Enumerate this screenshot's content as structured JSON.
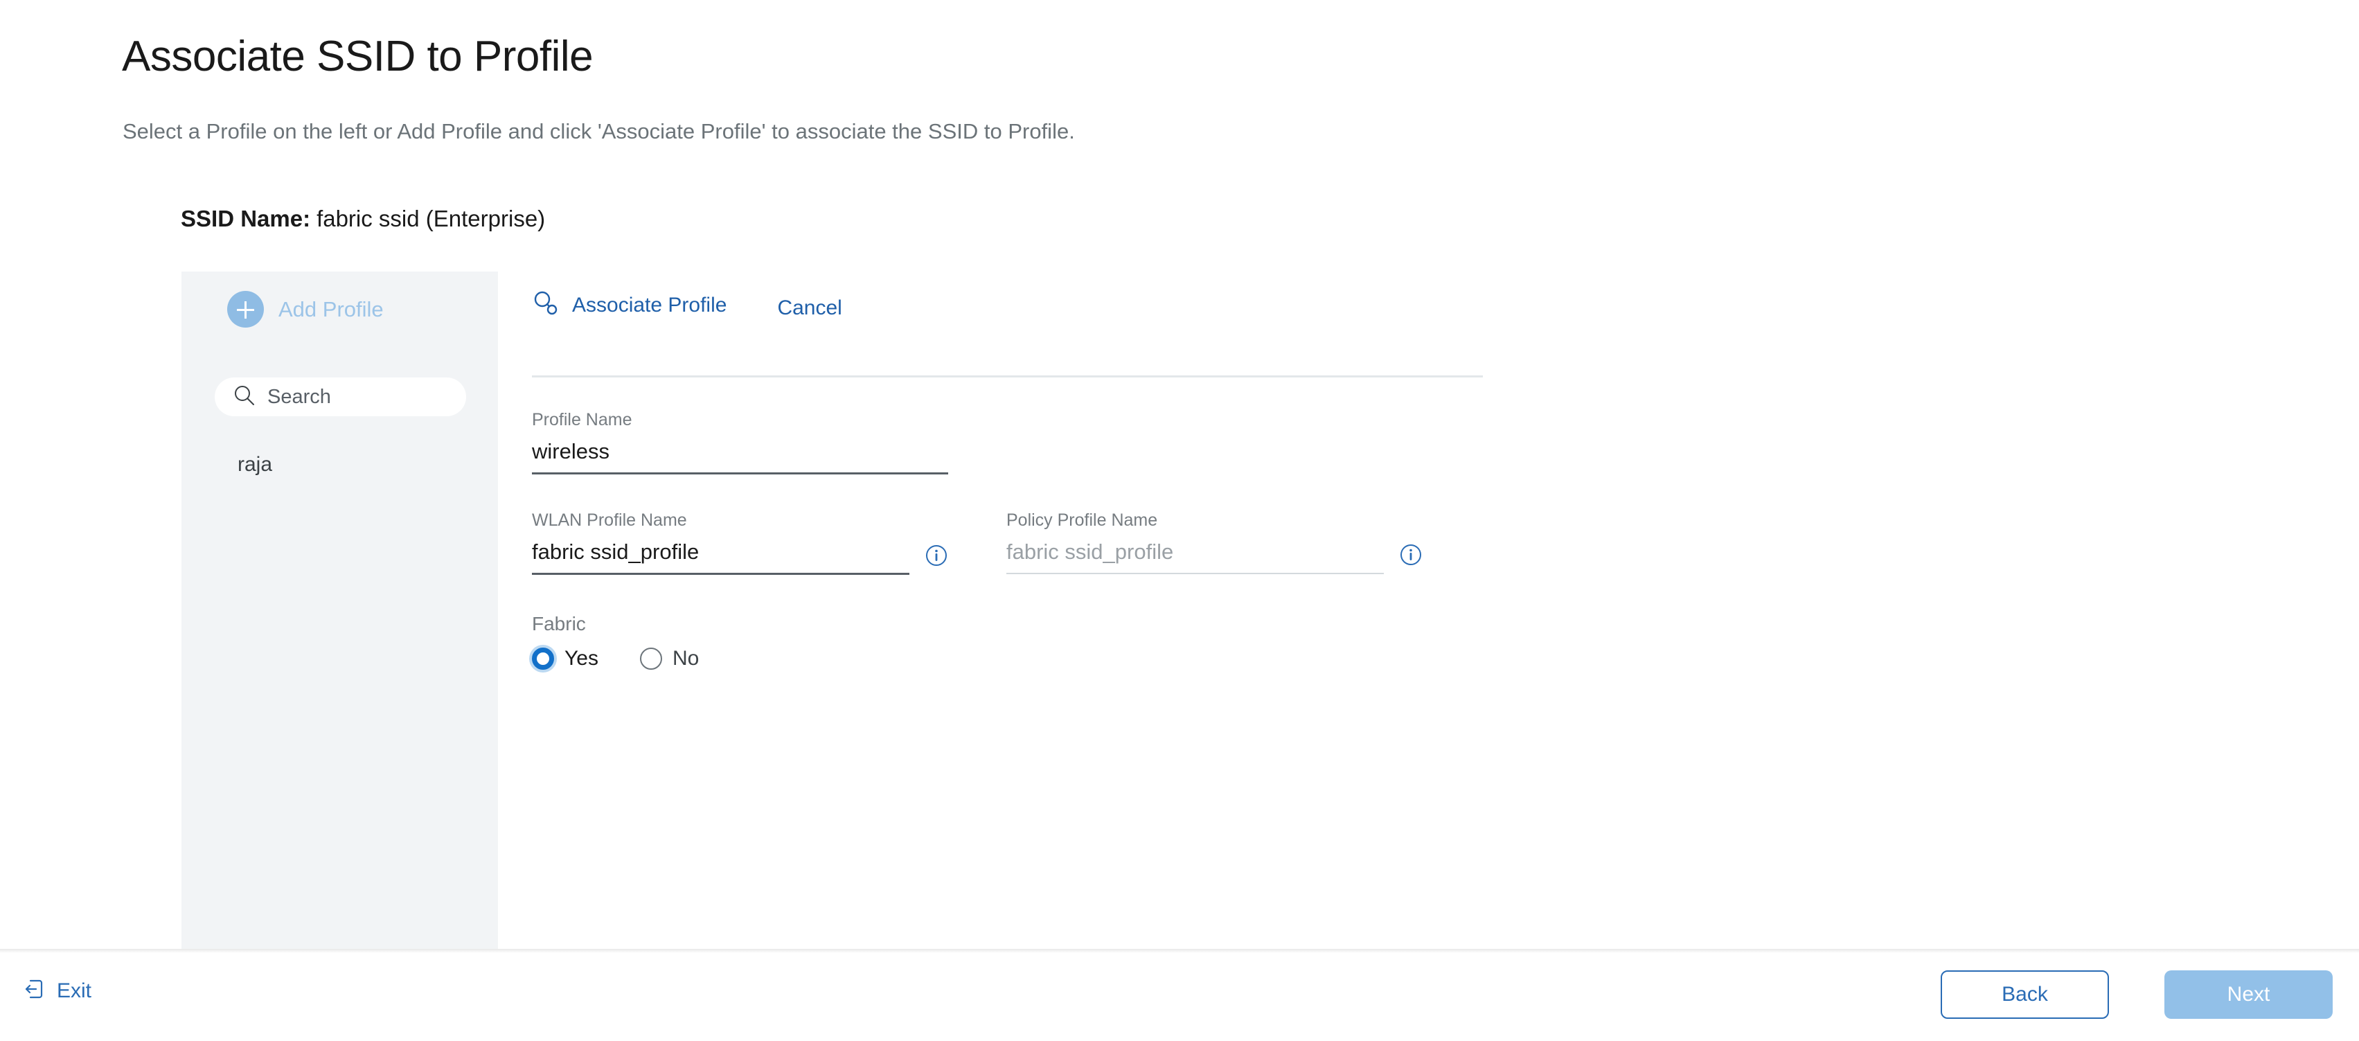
{
  "page": {
    "title": "Associate SSID to Profile",
    "subtitle": "Select a Profile on the left or Add Profile and click 'Associate Profile' to associate the SSID to Profile.",
    "ssid_label": "SSID Name:",
    "ssid_value": "fabric ssid (Enterprise)"
  },
  "sidebar": {
    "add_profile_label": "Add Profile",
    "add_profile_icon": "plus-circle-icon",
    "search": {
      "icon": "search-icon",
      "placeholder": "Search",
      "value": ""
    },
    "profiles": [
      {
        "label": "raja"
      }
    ]
  },
  "form": {
    "associate_label": "Associate Profile",
    "associate_icon": "associate-link-icon",
    "cancel_label": "Cancel",
    "fields": {
      "profile_name": {
        "label": "Profile Name",
        "value": "wireless",
        "placeholder": "",
        "is_placeholder": false
      },
      "wlan_profile_name": {
        "label": "WLAN Profile Name",
        "value": "fabric ssid_profile",
        "placeholder": "",
        "is_placeholder": false,
        "info_icon": "info-icon"
      },
      "policy_profile_name": {
        "label": "Policy Profile Name",
        "value": "",
        "placeholder": "fabric ssid_profile",
        "is_placeholder": true,
        "info_icon": "info-icon"
      }
    },
    "fabric": {
      "label": "Fabric",
      "selected": "Yes",
      "options": [
        {
          "label": "Yes",
          "selected": true
        },
        {
          "label": "No",
          "selected": false
        }
      ]
    }
  },
  "footer": {
    "exit_label": "Exit",
    "exit_icon": "exit-arrow-icon",
    "back_label": "Back",
    "next_label": "Next"
  },
  "colors": {
    "accent_blue": "#1f5fa9",
    "link_blue": "#2a6cb5",
    "light_blue": "#92c0e8",
    "panel_grey": "#f2f4f6",
    "radio_selected": "#1270c9"
  }
}
